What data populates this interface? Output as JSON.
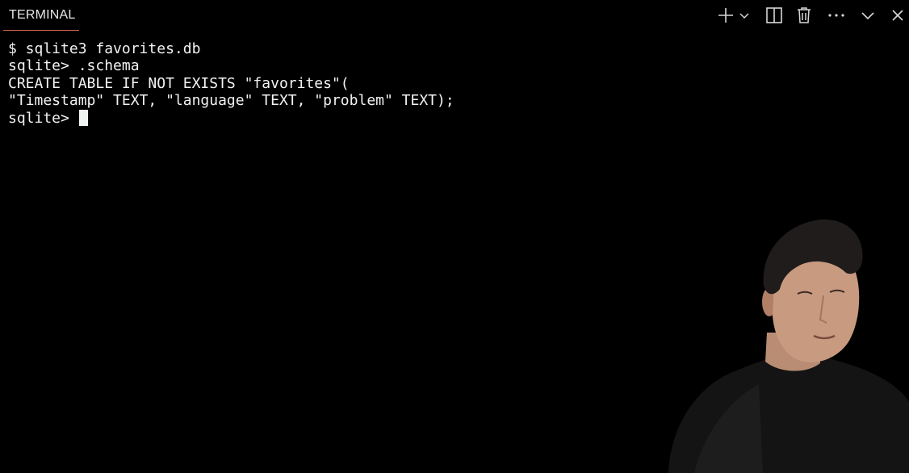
{
  "panel": {
    "tab_label": "TERMINAL",
    "actions": [
      {
        "name": "new-terminal",
        "icon": "plus-icon"
      },
      {
        "name": "launch-profile",
        "icon": "chevron-down-icon"
      },
      {
        "name": "split-terminal",
        "icon": "split-icon"
      },
      {
        "name": "kill-terminal",
        "icon": "trash-icon"
      },
      {
        "name": "more-actions",
        "icon": "ellipsis-icon"
      },
      {
        "name": "maximize-panel",
        "icon": "chevron-down-icon"
      },
      {
        "name": "close-panel",
        "icon": "close-icon"
      }
    ]
  },
  "terminal": {
    "lines": [
      "$ sqlite3 favorites.db",
      "sqlite> .schema",
      "CREATE TABLE IF NOT EXISTS \"favorites\"(",
      "\"Timestamp\" TEXT, \"language\" TEXT, \"problem\" TEXT);"
    ],
    "prompt": "sqlite> "
  },
  "colors": {
    "background": "#000000",
    "text": "#f2f2f2",
    "tab_accent": "#e36d5b",
    "cursor": "#f0f4f0"
  }
}
